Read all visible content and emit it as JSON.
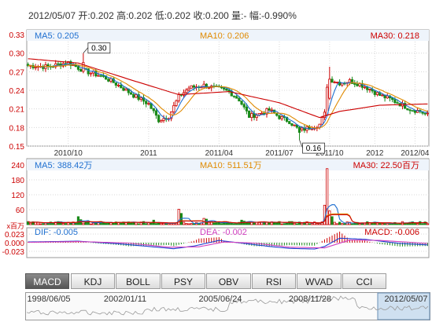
{
  "header": {
    "summary": "2012/05/07 开:0.202 高:0.202 低:0.202 收:0.200 量:- 幅:-0.990%"
  },
  "indicators": {
    "price": {
      "ma5": "MA5: 0.205",
      "ma10": "MA10: 0.206",
      "ma30": "MA30: 0.218",
      "ma5_color": "#1e6fd0",
      "ma10_color": "#e08a00",
      "ma30_color": "#cc0000"
    },
    "volume": {
      "ma5": "MA5: 388.42万",
      "ma10": "MA10: 511.51万",
      "ma30": "MA30: 22.50百万",
      "unit": "x百万"
    },
    "macd": {
      "dif": "DIF: -0.005",
      "dea": "DEA: -0.002",
      "macd": "MACD: -0.006",
      "dif_color": "#1e3fd0",
      "dea_color": "#d040c0"
    }
  },
  "tabs": [
    "MACD",
    "KDJ",
    "BOLL",
    "PSY",
    "OBV",
    "RSI",
    "WVAD",
    "CCI"
  ],
  "active_tab": "MACD",
  "timeline": {
    "labels": [
      "1998/06/05",
      "2002/01/11",
      "2005/06/24",
      "2008/11/28",
      "2012/05/07"
    ]
  },
  "colors": {
    "up": "#cc0000",
    "down": "#1a8a1a",
    "grid": "#d8d8d8",
    "axis_text": "#cc0000"
  },
  "chart_data": [
    {
      "type": "candlestick",
      "title": "price",
      "ylim": [
        0.15,
        0.33
      ],
      "yticks": [
        "0.33",
        "0.30",
        "0.27",
        "0.24",
        "0.21",
        "0.18",
        "0.15"
      ],
      "xticks": [
        "2010/10",
        "2011",
        "2011/04",
        "2011/07",
        "2011/10",
        "2012",
        "2012/04"
      ],
      "annotations": [
        {
          "label": "0.30",
          "note": "high marker",
          "value": 0.3
        },
        {
          "label": "0.16",
          "note": "low marker",
          "value": 0.16
        }
      ],
      "close_anchors": [
        [
          0,
          0.28
        ],
        [
          8,
          0.278
        ],
        [
          16,
          0.285
        ],
        [
          22,
          0.272
        ],
        [
          30,
          0.262
        ],
        [
          36,
          0.248
        ],
        [
          42,
          0.232
        ],
        [
          48,
          0.218
        ],
        [
          52,
          0.192
        ],
        [
          56,
          0.198
        ],
        [
          60,
          0.23
        ],
        [
          64,
          0.244
        ],
        [
          70,
          0.248
        ],
        [
          76,
          0.242
        ],
        [
          80,
          0.238
        ],
        [
          84,
          0.225
        ],
        [
          88,
          0.198
        ],
        [
          92,
          0.202
        ],
        [
          96,
          0.208
        ],
        [
          100,
          0.197
        ],
        [
          104,
          0.19
        ],
        [
          108,
          0.175
        ],
        [
          112,
          0.18
        ],
        [
          116,
          0.185
        ],
        [
          118,
          0.202
        ],
        [
          120,
          0.258
        ],
        [
          124,
          0.252
        ],
        [
          128,
          0.255
        ],
        [
          132,
          0.25
        ],
        [
          136,
          0.242
        ],
        [
          140,
          0.232
        ],
        [
          144,
          0.226
        ],
        [
          148,
          0.218
        ],
        [
          152,
          0.21
        ],
        [
          156,
          0.206
        ],
        [
          159,
          0.2
        ]
      ],
      "ma30_anchors": [
        [
          0,
          0.291
        ],
        [
          20,
          0.284
        ],
        [
          40,
          0.258
        ],
        [
          60,
          0.233
        ],
        [
          80,
          0.238
        ],
        [
          100,
          0.22
        ],
        [
          116,
          0.196
        ],
        [
          124,
          0.206
        ],
        [
          140,
          0.216
        ],
        [
          159,
          0.218
        ]
      ]
    },
    {
      "type": "bar",
      "title": "volume",
      "ylim": [
        0,
        240
      ],
      "yticks": [
        "240",
        "180",
        "120",
        "60"
      ],
      "spikes": [
        [
          20,
          32
        ],
        [
          21,
          20
        ],
        [
          50,
          18
        ],
        [
          60,
          62
        ],
        [
          61,
          45
        ],
        [
          70,
          25
        ],
        [
          71,
          22
        ],
        [
          85,
          18
        ],
        [
          86,
          14
        ],
        [
          118,
          78
        ],
        [
          119,
          225
        ],
        [
          120,
          55
        ],
        [
          121,
          32
        ]
      ],
      "base_level": 7
    },
    {
      "type": "line",
      "title": "macd",
      "ylim": [
        -0.023,
        0.023
      ],
      "yticks": [
        "0.023",
        "0.000",
        "-0.023"
      ],
      "dif_anchors": [
        [
          0,
          0.002
        ],
        [
          20,
          0.004
        ],
        [
          36,
          -0.003
        ],
        [
          48,
          -0.01
        ],
        [
          58,
          -0.016
        ],
        [
          66,
          -0.009
        ],
        [
          76,
          0.006
        ],
        [
          86,
          -0.002
        ],
        [
          96,
          -0.01
        ],
        [
          104,
          -0.015
        ],
        [
          114,
          -0.017
        ],
        [
          118,
          -0.01
        ],
        [
          124,
          0.012
        ],
        [
          134,
          0.009
        ],
        [
          148,
          -0.002
        ],
        [
          159,
          -0.006
        ]
      ],
      "dea_anchors": [
        [
          0,
          0.001
        ],
        [
          20,
          0.003
        ],
        [
          40,
          -0.001
        ],
        [
          56,
          -0.012
        ],
        [
          68,
          -0.011
        ],
        [
          78,
          0.002
        ],
        [
          90,
          -0.001
        ],
        [
          104,
          -0.012
        ],
        [
          118,
          -0.014
        ],
        [
          128,
          0.007
        ],
        [
          140,
          0.006
        ],
        [
          159,
          -0.002
        ]
      ]
    }
  ]
}
